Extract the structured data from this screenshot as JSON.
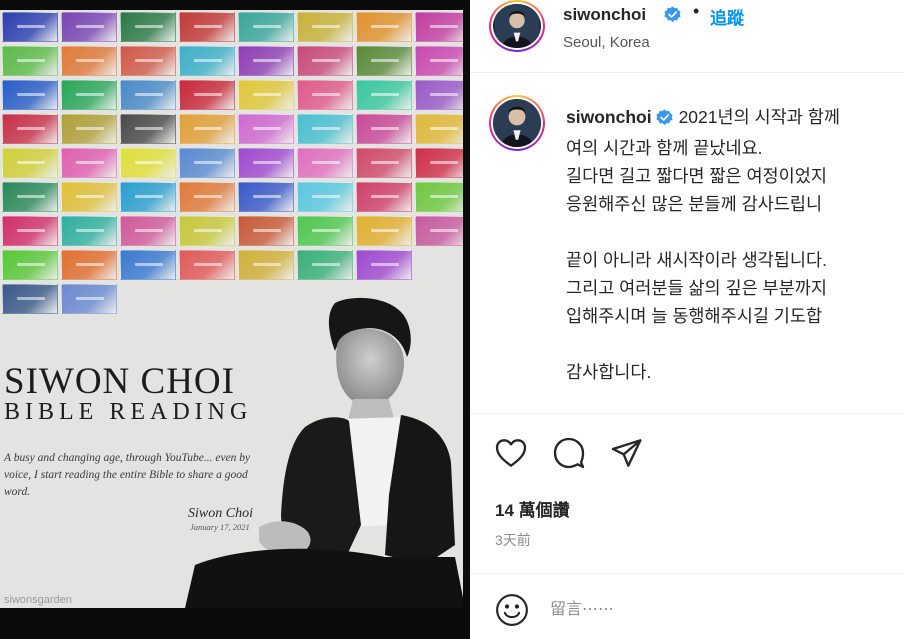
{
  "post": {
    "poster": {
      "title": "SIWON CHOI",
      "subtitle": "BIBLE READING",
      "tagline": "A busy and changing age, through YouTube... even by voice, I start reading the entire Bible to share a good word.",
      "signature": "Siwon Choi",
      "date": "January 17, 2021",
      "handle": "siwonsgarden",
      "tile_colors": [
        [
          "#2c3fb0",
          "#7a45b5",
          "#2a7a48",
          "#c23a3a",
          "#3aa79b",
          "#c8b23a",
          "#e0932e",
          "#c23ea3"
        ],
        [
          "#5dbb4a",
          "#e07a3a",
          "#d05a4a",
          "#3db0c8",
          "#8e3fb5",
          "#c84a7a",
          "#5a8a3a",
          "#c84ab0"
        ],
        [
          "#2a5dc8",
          "#2aa75a",
          "#4a8ac8",
          "#c82a3a",
          "#e0c83a",
          "#e05a8a",
          "#3ac8a0",
          "#9a5ac8"
        ],
        [
          "#c8304a",
          "#b0a03a",
          "#4a4a4a",
          "#e0a03a",
          "#d06ad0",
          "#4ac0d0",
          "#c84a9a",
          "#e0b83a"
        ],
        [
          "#d0d03a",
          "#e060b0",
          "#e0e03a",
          "#5a8ad0",
          "#a04ad0",
          "#e070c0",
          "#d04a6a",
          "#d0304a"
        ],
        [
          "#2a8a5a",
          "#e0c03a",
          "#2aa0d0",
          "#e07a3a",
          "#3a5ac8",
          "#5ac8e0",
          "#d0406a",
          "#70c840"
        ],
        [
          "#d0306a",
          "#30b0a0",
          "#d05a9a",
          "#c8c83a",
          "#c85a3a",
          "#50c850",
          "#e0b030",
          "#c85aa0"
        ],
        [
          "#5ac83a",
          "#e07030",
          "#3a7ad0",
          "#e05a5a",
          "#d0b03a",
          "#3ab07a",
          "#a04ad0",
          ""
        ],
        [
          "#3a5a8a",
          "#6a8ad0",
          "",
          "",
          "",
          "",
          "",
          ""
        ]
      ]
    }
  },
  "header": {
    "username": "siwonchoi",
    "dot": "•",
    "follow_label": "追蹤",
    "location": "Seoul, Korea"
  },
  "caption": {
    "username": "siwonchoi",
    "lines": [
      "2021년의 시작과 함께",
      "여의 시간과 함께 끝났네요.",
      "길다면 길고 짧다면 짧은 여정이었지",
      "응원해주신 많은 분들께 감사드립니",
      "",
      "끝이 아니라 새시작이라 생각됩니다.",
      "그리고 여러분들 삶의 깊은 부분까지",
      "입해주시며 늘 동행해주시길 기도합",
      "",
      "감사합니다."
    ]
  },
  "actions": {
    "icons": [
      "heart-icon",
      "comment-icon",
      "share-icon"
    ]
  },
  "likes": "14 萬個讚",
  "timestamp": "3天前",
  "comment": {
    "placeholder": "留言⋯⋯"
  },
  "colors": {
    "accent": "#0095f6",
    "verified": "#3897f0",
    "text": "#262626",
    "muted": "#8e8e8e"
  }
}
